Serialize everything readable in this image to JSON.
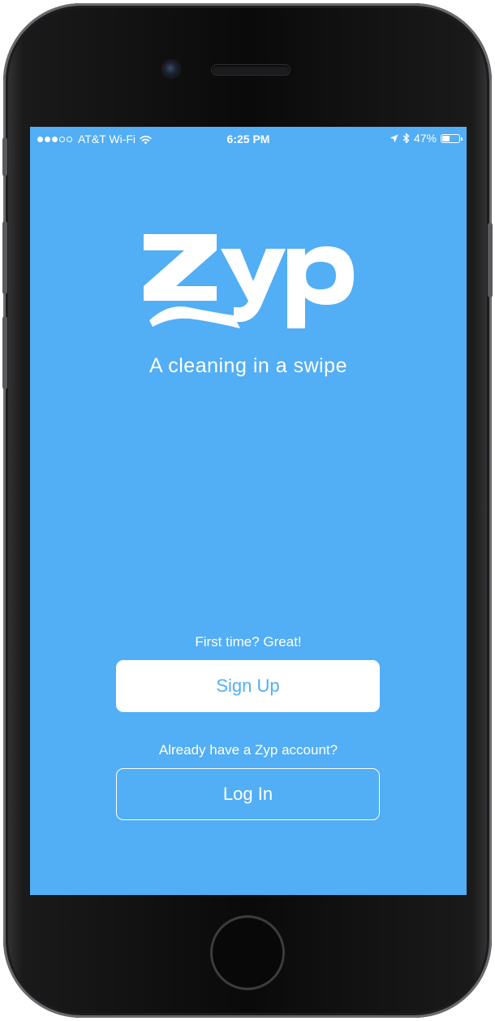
{
  "status_bar": {
    "carrier": "AT&T Wi-Fi",
    "time": "6:25 PM",
    "battery": "47%",
    "battery_level": 0.47,
    "signal_bars_filled": 3,
    "signal_bars_total": 5,
    "icons": [
      "signal-dots-icon",
      "wifi-icon",
      "location-arrow-icon",
      "bluetooth-icon",
      "battery-icon"
    ]
  },
  "brand": {
    "logo_text": "zyp",
    "tagline": "A cleaning in a swipe"
  },
  "signup": {
    "prompt": "First time? Great!",
    "button_label": "Sign Up"
  },
  "login": {
    "prompt": "Already have a Zyp account?",
    "button_label": "Log In"
  },
  "colors": {
    "screen_background": "#52aef5",
    "text": "#ffffff",
    "signup_button_bg": "#ffffff",
    "signup_button_text": "#52aef5"
  }
}
